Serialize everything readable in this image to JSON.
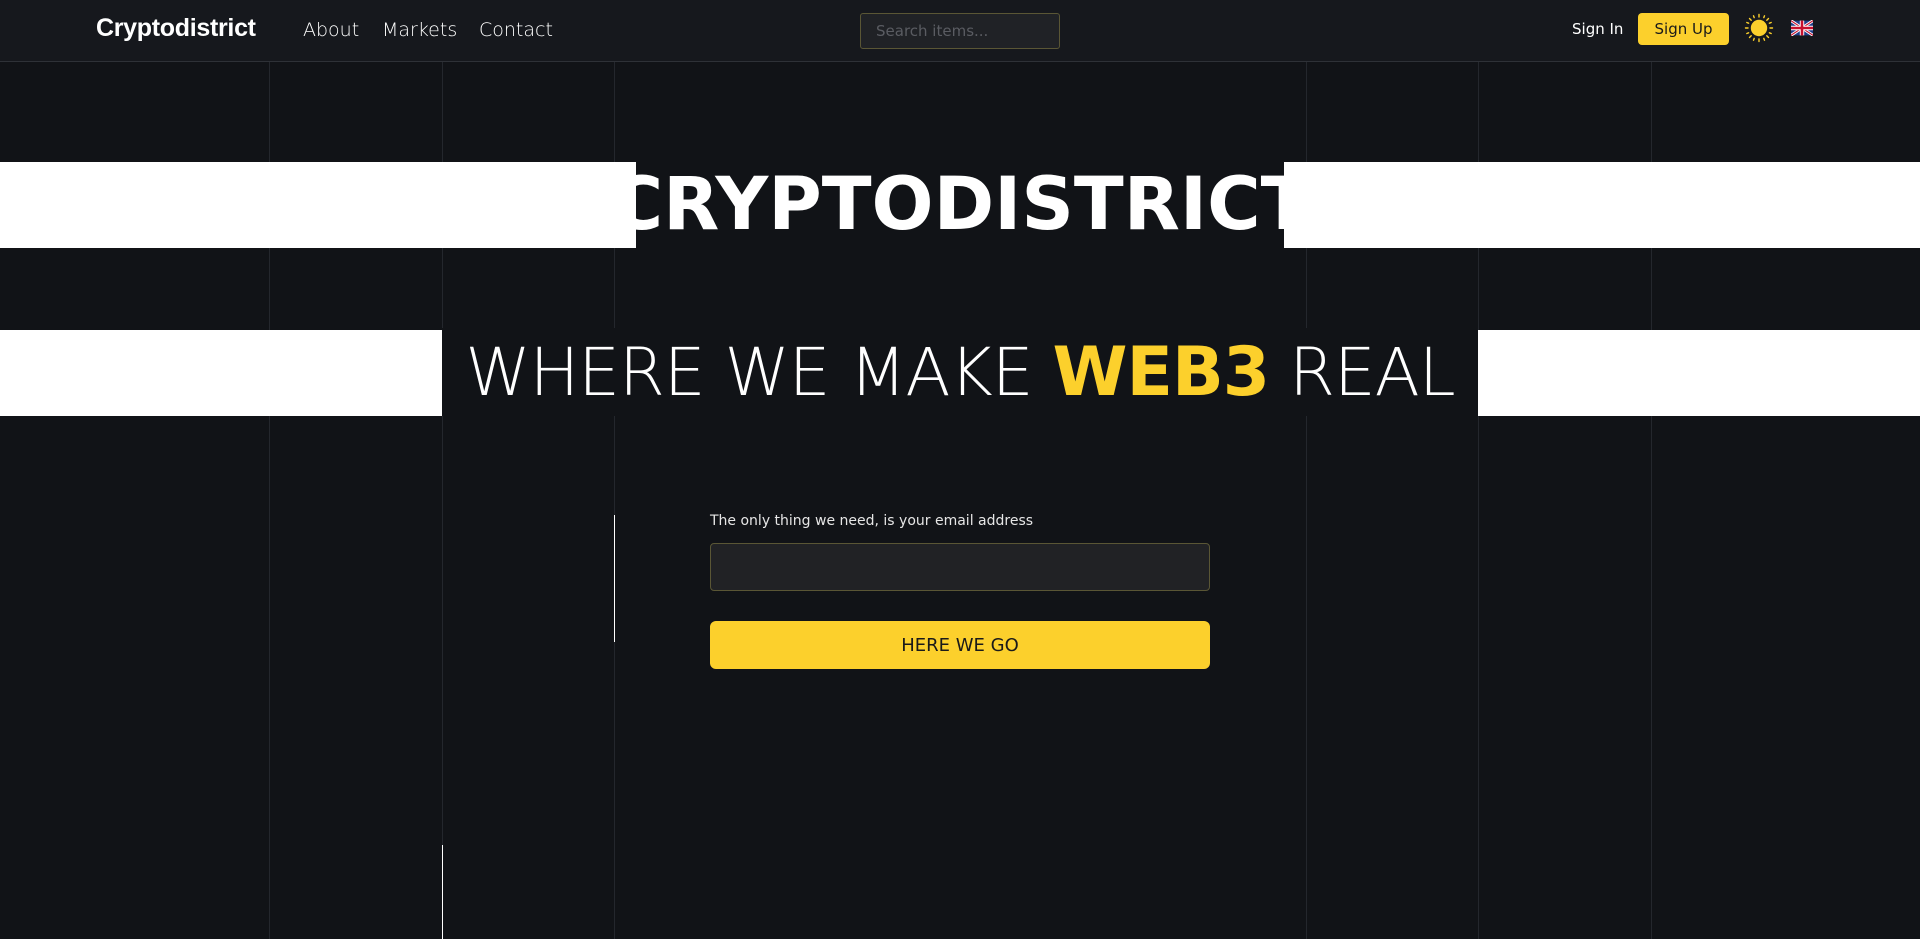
{
  "navbar": {
    "brand": "Cryptodistrict",
    "links": [
      {
        "label": "About"
      },
      {
        "label": "Markets"
      },
      {
        "label": "Contact"
      }
    ],
    "search": {
      "placeholder": "Search items...",
      "value": ""
    },
    "sign_in_label": "Sign In",
    "sign_up_label": "Sign Up",
    "theme_icon": "sun-icon",
    "language_icon": "uk-flag-icon"
  },
  "hero": {
    "title": "CRYPTODISTRICT",
    "tagline_before": "WHERE WE MAKE ",
    "tagline_highlight": "WEB3",
    "tagline_after": " REAL"
  },
  "signup_form": {
    "email_label": "The only thing we need, is your email address",
    "email_value": "",
    "submit_label": "HERE WE GO"
  },
  "colors": {
    "background": "#111317",
    "accent": "#fcd02c",
    "band": "#ffffff"
  }
}
